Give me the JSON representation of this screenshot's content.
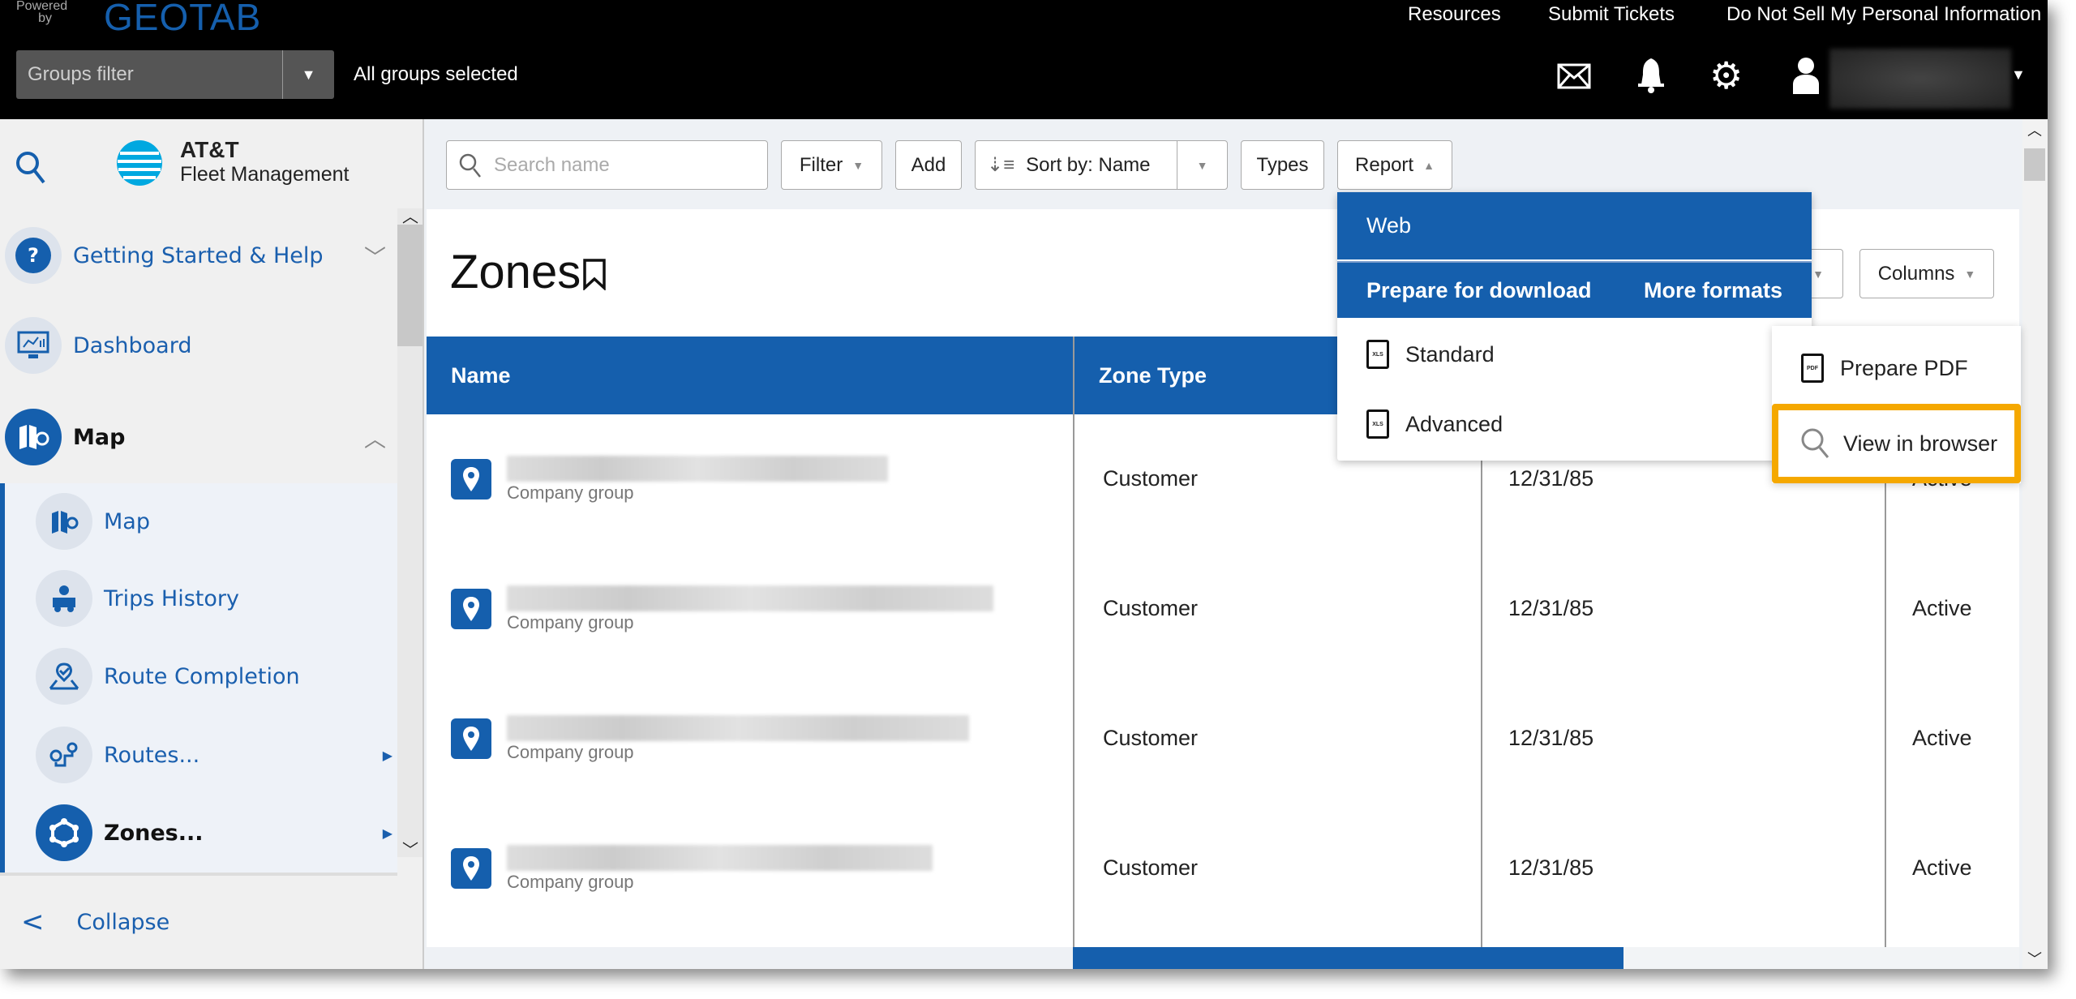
{
  "topbar": {
    "powered_by": "Powered by",
    "brand": "GEOTAB",
    "links": [
      "Resources",
      "Submit Tickets",
      "Do Not Sell My Personal Information"
    ],
    "groups_filter_placeholder": "Groups filter",
    "groups_status": "All groups selected",
    "icons": [
      "mail-icon",
      "bell-icon",
      "gear-icon",
      "user-icon"
    ]
  },
  "sidebar": {
    "logo_line1": "AT&T",
    "logo_line2": "Fleet Management",
    "items": [
      {
        "label": "Getting Started & Help"
      },
      {
        "label": "Dashboard"
      },
      {
        "label": "Map"
      }
    ],
    "subitems": [
      {
        "label": "Map"
      },
      {
        "label": "Trips History"
      },
      {
        "label": "Route Completion"
      },
      {
        "label": "Routes..."
      },
      {
        "label": "Zones..."
      }
    ],
    "collapse": "Collapse"
  },
  "toolbar": {
    "search_placeholder": "Search name",
    "filter": "Filter",
    "add": "Add",
    "sort_prefix": "Sort by:",
    "sort_value": "Name",
    "types": "Types",
    "report": "Report",
    "columns": "Columns"
  },
  "page": {
    "title": "Zones"
  },
  "table": {
    "headers": [
      "Name",
      "Zone Type"
    ],
    "rows": [
      {
        "group": "Company group",
        "type": "Customer",
        "date": "12/31/85",
        "status": "Active"
      },
      {
        "group": "Company group",
        "type": "Customer",
        "date": "12/31/85",
        "status": "Active"
      },
      {
        "group": "Company group",
        "type": "Customer",
        "date": "12/31/85",
        "status": "Active"
      },
      {
        "group": "Company group",
        "type": "Customer",
        "date": "12/31/85",
        "status": "Active"
      }
    ]
  },
  "report_menu": {
    "web": "Web",
    "prepare": "Prepare for download",
    "more": "More formats",
    "items": [
      "Standard",
      "Advanced"
    ],
    "file_badge": "XLS"
  },
  "more_formats_menu": {
    "items": [
      "Prepare PDF",
      "View in browser"
    ],
    "pdf_badge": "PDF",
    "highlight_color": "#f5a800"
  },
  "colors": {
    "accent": "#155fad",
    "topbar": "#000000"
  }
}
